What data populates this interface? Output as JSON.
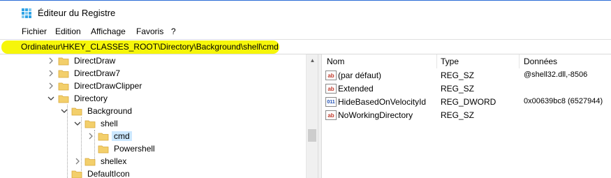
{
  "window": {
    "title": "Éditeur du Registre",
    "icon": "regedit-icon"
  },
  "menu": {
    "items": [
      "Fichier",
      "Edition",
      "Affichage",
      "Favoris",
      "?"
    ]
  },
  "address": {
    "path": "Ordinateur\\HKEY_CLASSES_ROOT\\Directory\\Background\\shell\\cmd",
    "highlight_color": "#f6f60a"
  },
  "tree": {
    "nodes": [
      {
        "label": "DirectDraw",
        "state": "collapsed"
      },
      {
        "label": "DirectDraw7",
        "state": "collapsed"
      },
      {
        "label": "DirectDrawClipper",
        "state": "collapsed"
      },
      {
        "label": "Directory",
        "state": "expanded"
      },
      {
        "label": "Background",
        "state": "expanded"
      },
      {
        "label": "shell",
        "state": "expanded"
      },
      {
        "label": "cmd",
        "state": "collapsed",
        "selected": true
      },
      {
        "label": "Powershell",
        "state": "leaf"
      },
      {
        "label": "shellex",
        "state": "collapsed"
      },
      {
        "label": "DefaultIcon",
        "state": "leaf"
      }
    ],
    "selection_color": "#cce8ff"
  },
  "list": {
    "columns": [
      "Nom",
      "Type",
      "Données"
    ],
    "rows": [
      {
        "icon": "string-value-icon",
        "name": "(par défaut)",
        "type": "REG_SZ",
        "data": "@shell32.dll,-8506"
      },
      {
        "icon": "string-value-icon",
        "name": "Extended",
        "type": "REG_SZ",
        "data": ""
      },
      {
        "icon": "dword-value-icon",
        "name": "HideBasedOnVelocityId",
        "type": "REG_DWORD",
        "data": "0x00639bc8 (6527944)"
      },
      {
        "icon": "string-value-icon",
        "name": "NoWorkingDirectory",
        "type": "REG_SZ",
        "data": ""
      }
    ]
  },
  "colors": {
    "folder": "#f3cf6b",
    "titlebar_accent": "#2b6cd6"
  }
}
